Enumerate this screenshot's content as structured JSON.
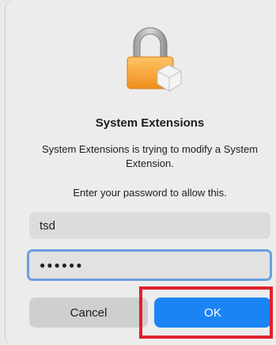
{
  "dialog": {
    "title": "System Extensions",
    "message": "System Extensions is trying to modify a System Extension.",
    "prompt": "Enter your password to allow this.",
    "username_value": "tsd",
    "password_mask": "●●●●●●",
    "cancel_label": "Cancel",
    "ok_label": "OK",
    "icon": "lock-icon"
  },
  "colors": {
    "ok_button": "#1b84f5",
    "focus_ring": "#6a9ee0",
    "highlight_box": "#e0212b"
  }
}
